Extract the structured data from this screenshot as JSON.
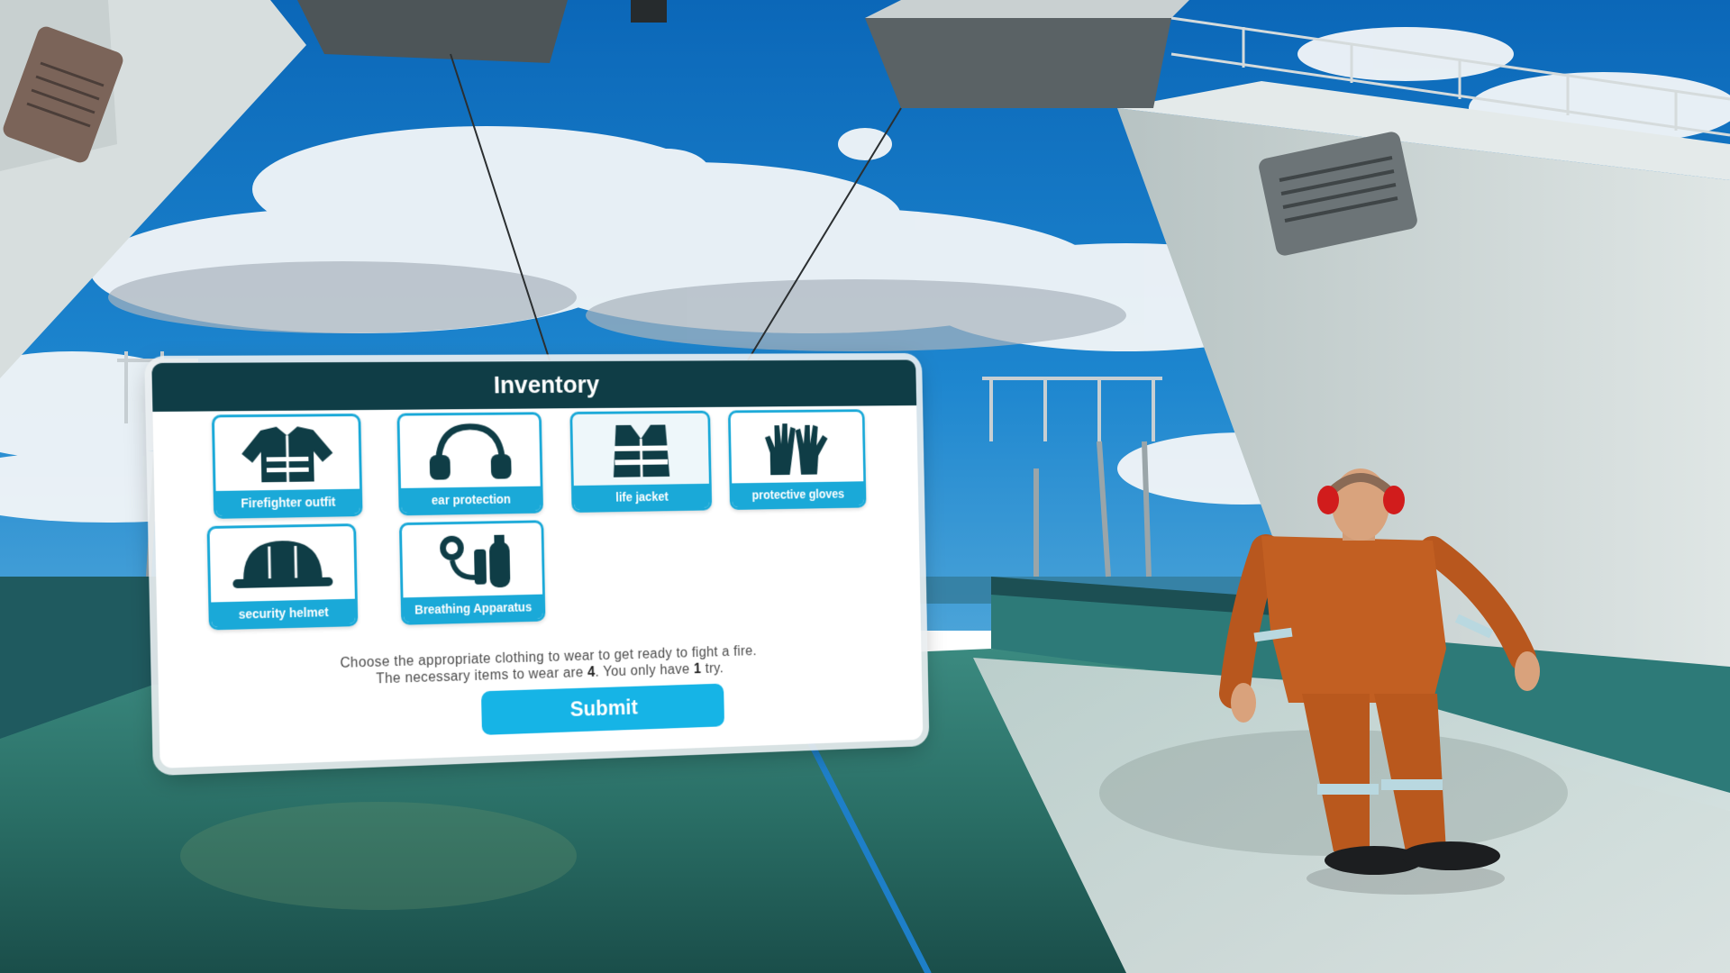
{
  "panel": {
    "title": "Inventory",
    "items": [
      {
        "label": "Firefighter outfit",
        "icon": "firefighter-outfit-icon"
      },
      {
        "label": "ear protection",
        "icon": "ear-protection-icon"
      },
      {
        "label": "life jacket",
        "icon": "life-jacket-icon",
        "selected": true
      },
      {
        "label": "protective gloves",
        "icon": "protective-gloves-icon"
      },
      {
        "label": "security helmet",
        "icon": "security-helmet-icon"
      },
      {
        "label": "Breathing Apparatus",
        "icon": "breathing-apparatus-icon"
      }
    ],
    "instructions": {
      "line1": "Choose the appropriate clothing to wear to get ready to fight a fire.",
      "line2_pre": "The necessary items to wear are ",
      "items_required": "4",
      "line2_mid": ". You only have ",
      "tries": "1",
      "line2_post": " try."
    },
    "submit_label": "Submit"
  },
  "colors": {
    "header": "#0f3d46",
    "accent": "#1aa9d8",
    "icon": "#0f3d46",
    "pointer_ray": "#1e7fc8"
  }
}
